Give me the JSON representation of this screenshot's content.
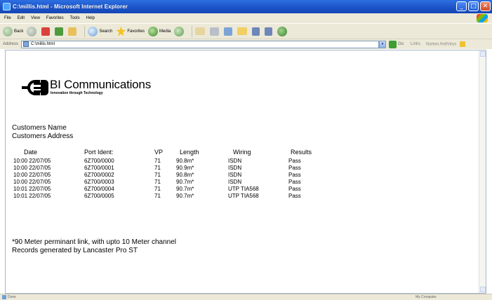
{
  "window": {
    "title": "C:\\millis.html - Microsoft Internet Explorer",
    "controls": [
      "_",
      "□",
      "✕"
    ]
  },
  "menu": [
    "File",
    "Edit",
    "View",
    "Favorites",
    "Tools",
    "Help"
  ],
  "toolbar": {
    "back": "Back",
    "search": "Search",
    "favorites": "Favorites",
    "media": "Media"
  },
  "address": {
    "label": "Address",
    "value": "C:\\millis.html",
    "go": "Go",
    "links": "Links",
    "norton": "Norton AntiVirus"
  },
  "page": {
    "logo_name": "BI Communications",
    "logo_tagline": "Innovation through Technology",
    "customer_name": "Customers Name",
    "customer_address": "Customers Address",
    "columns": [
      "Date",
      "Port Ident:",
      "VP",
      "Length",
      "Wiring",
      "Results"
    ],
    "rows": [
      [
        "10:00 22/07/05",
        "6Z700/0000",
        "71",
        "90.8m*",
        "ISDN",
        "Pass"
      ],
      [
        "10:00 22/07/05",
        "6Z700/0001",
        "71",
        "90.9m*",
        "ISDN",
        "Pass"
      ],
      [
        "10:00 22/07/05",
        "6Z700/0002",
        "71",
        "90.8m*",
        "ISDN",
        "Pass"
      ],
      [
        "10:00 22/07/05",
        "6Z700/0003",
        "71",
        "90.7m*",
        "ISDN",
        "Pass"
      ],
      [
        "10:01 22/07/05",
        "6Z700/0004",
        "71",
        "90.7m*",
        "UTP TIA568",
        "Pass"
      ],
      [
        "10:01 22/07/05",
        "6Z700/0005",
        "71",
        "90.7m*",
        "UTP TIA568",
        "Pass"
      ]
    ],
    "note1": "*90 Meter perminant link, with upto 10 Meter channel",
    "note2": "Records generated by Lancaster Pro ST"
  },
  "status": {
    "left": "Done",
    "right": "My Computer"
  },
  "colors": {
    "titlebar": "#1a52c8",
    "chrome": "#ece9d8",
    "close_button": "#d24b23"
  }
}
